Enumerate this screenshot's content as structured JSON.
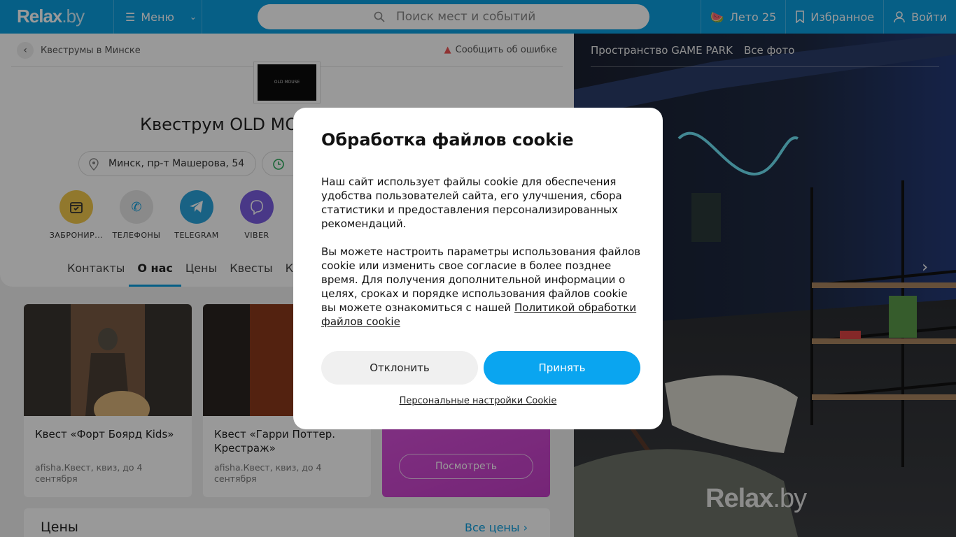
{
  "header": {
    "logo_main": "Relax",
    "logo_suffix": ".by",
    "menu_label": "Меню",
    "search_placeholder": "Поиск мест и событий",
    "summer_label": "Лето 25",
    "favorites_label": "Избранное",
    "login_label": "Войти"
  },
  "page": {
    "breadcrumb": "Квеструмы в Минске",
    "report_label": "Сообщить об ошибке",
    "logo_text": "OLD MOUSE",
    "title": "Квеструм OLD MO",
    "address": "Минск, пр-т Машерова, 54",
    "actions": [
      {
        "label": "ЗАБРОНИР...",
        "color": "#f2c94c"
      },
      {
        "label": "ТЕЛЕФОНЫ",
        "color": "#e0e0e0"
      },
      {
        "label": "TELEGRAM",
        "color": "#2aa3dc"
      },
      {
        "label": "VIBER",
        "color": "#7b5ee2"
      }
    ],
    "tabs": [
      "Контакты",
      "О нас",
      "Цены",
      "Квесты",
      "К"
    ],
    "active_tab": "О нас"
  },
  "quests": [
    {
      "title": "Квест «Форт Боярд Kids»",
      "meta": "afisha.Квест, квиз, до 4 сентября"
    },
    {
      "title": "Квест «Гарри Поттер. Крестраж»",
      "meta": "afisha.Квест, квиз, до 4 сентября"
    }
  ],
  "promo": {
    "button_label": "Посмотреть"
  },
  "prices": {
    "heading": "Цены",
    "all_label": "Все цены"
  },
  "photo": {
    "place_name": "Пространство GAME PARK",
    "all_photos": "Все фото",
    "watermark_main": "Relax",
    "watermark_suffix": ".by"
  },
  "cookie": {
    "title": "Обработка файлов cookie",
    "paragraph1": "Наш сайт использует файлы cookie для обеспечения удобства пользователей сайта, его улучшения, сбора статистики и предоставления персонализированных рекомендаций.",
    "paragraph2": "Вы можете настроить параметры использования файлов cookie или изменить свое согласие в более позднее время. Для получения дополнительной информации о целях, сроках и порядке использования файлов cookie вы можете ознакомиться с нашей",
    "policy_link": "Политикой обработки файлов cookie",
    "decline_label": "Отклонить",
    "accept_label": "Принять",
    "personal_settings": "Персональные настройки Cookie"
  },
  "colors": {
    "brand": "#0a9ee0",
    "accept": "#0aa5f0",
    "promo": "#d44fd7"
  }
}
